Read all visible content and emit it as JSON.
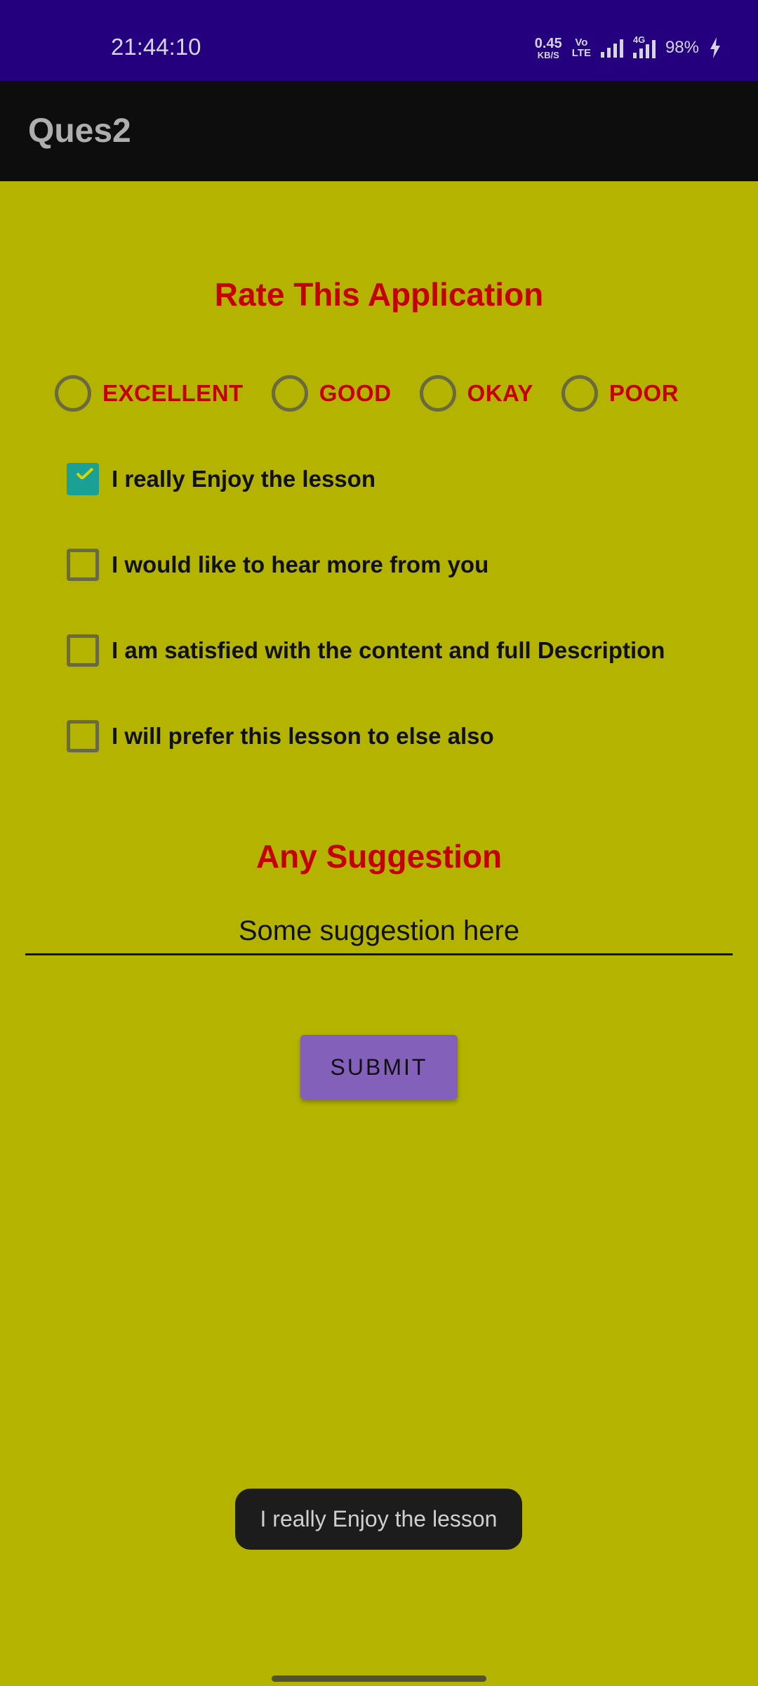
{
  "status_bar": {
    "time": "21:44:10",
    "net_speed_value": "0.45",
    "net_speed_unit": "KB/S",
    "volte_top": "Vo",
    "volte_bottom": "LTE",
    "signal_tag": "4G",
    "battery": "98%",
    "background": "#24007f"
  },
  "app_bar": {
    "title": "Ques2",
    "background": "#0d0d0d"
  },
  "rate": {
    "heading": "Rate This Application",
    "options": [
      {
        "label": "EXCELLENT",
        "selected": false
      },
      {
        "label": "GOOD",
        "selected": false
      },
      {
        "label": "OKAY",
        "selected": false
      },
      {
        "label": "POOR",
        "selected": false
      }
    ]
  },
  "checkboxes": [
    {
      "label": "I really Enjoy the lesson",
      "checked": true
    },
    {
      "label": "I would like to hear more from you",
      "checked": false
    },
    {
      "label": "I am satisfied with the content and full Description",
      "checked": false
    },
    {
      "label": "I will prefer this lesson to else also",
      "checked": false
    }
  ],
  "suggestion": {
    "heading": "Any Suggestion",
    "value": "Some suggestion here"
  },
  "submit_label": "SUBMIT",
  "toast": "I really Enjoy the lesson",
  "colors": {
    "background": "#b3b300",
    "accent_red": "#c40000",
    "checkbox_checked": "#1aa095",
    "button": "#8361bb"
  }
}
